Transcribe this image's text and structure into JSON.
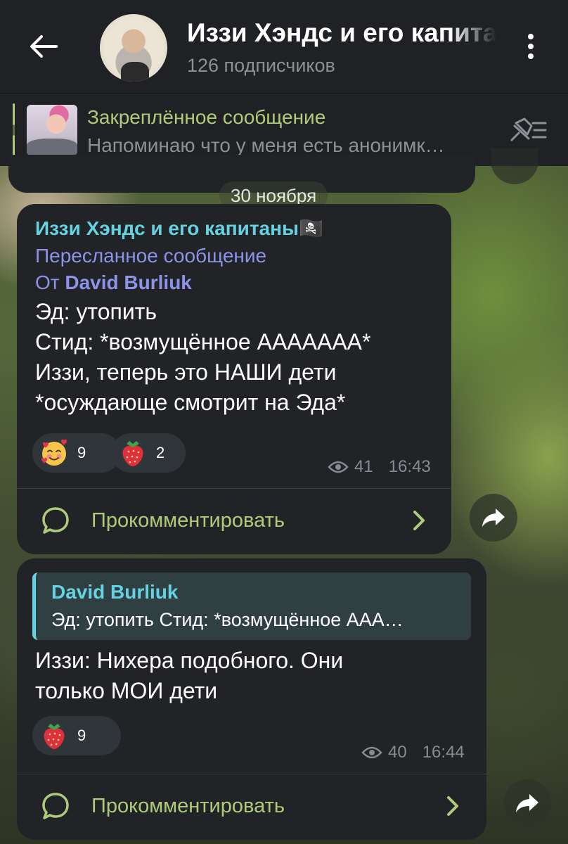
{
  "header": {
    "title": "Иззи Хэндс и его капитаны",
    "subscribers": "126 подписчиков"
  },
  "pinned": {
    "title": "Закреплённое сообщение",
    "text": "Напоминаю что у меня есть анонимк…"
  },
  "date_chip": "30 ноября",
  "messages": [
    {
      "channel": "Иззи Хэндс и его капитаны🏴‍☠️",
      "forwarded_label": "Пересланное сообщение",
      "from_prefix": "От",
      "from_name": "David Burliuk",
      "lines": [
        "Эд: утопить",
        "Стид: *возмущённое ААААААА*",
        "Иззи, теперь это НАШИ дети",
        "*осуждающе смотрит на Эда*"
      ],
      "reactions": [
        {
          "emoji": "smiling-face-with-hearts",
          "count": "9"
        },
        {
          "emoji": "strawberry",
          "count": "2"
        }
      ],
      "views": "41",
      "time": "16:43",
      "comment_label": "Прокомментировать"
    },
    {
      "reply_name": "David Burliuk",
      "reply_text": "Эд: утопить  Стид: *возмущённое ААА…",
      "lines": [
        "Иззи: Нихера подобного. Они",
        "только МОИ дети"
      ],
      "reactions": [
        {
          "emoji": "strawberry",
          "count": "9"
        }
      ],
      "views": "40",
      "time": "16:44",
      "comment_label": "Прокомментировать"
    }
  ]
}
